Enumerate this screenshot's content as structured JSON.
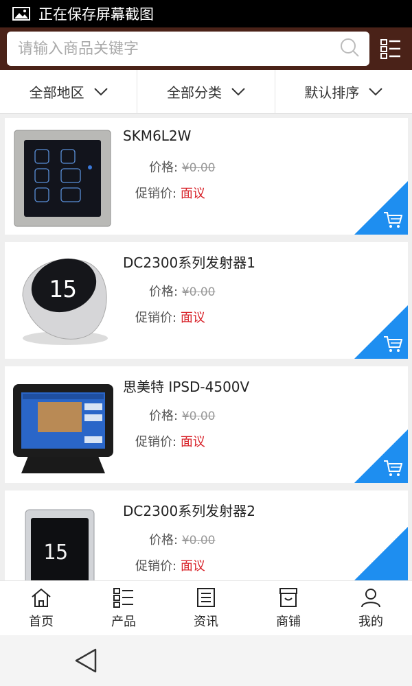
{
  "statusbar": {
    "text": "正在保存屏幕截图",
    "icon": "image-icon"
  },
  "search": {
    "placeholder": "请输入商品关键字",
    "icon": "search-icon",
    "menu_icon": "list-menu-icon"
  },
  "filters": [
    {
      "label": "全部地区"
    },
    {
      "label": "全部分类"
    },
    {
      "label": "默认排序"
    }
  ],
  "products": [
    {
      "name": "SKM6L2W",
      "price_label": "价格:",
      "price": "¥0.00",
      "promo_label": "促销价:",
      "promo": "面议"
    },
    {
      "name": "DC2300系列发射器1",
      "price_label": "价格:",
      "price": "¥0.00",
      "promo_label": "促销价:",
      "promo": "面议"
    },
    {
      "name": "思美特 IPSD-4500V",
      "price_label": "价格:",
      "price": "¥0.00",
      "promo_label": "促销价:",
      "promo": "面议"
    },
    {
      "name": "DC2300系列发射器2",
      "price_label": "价格:",
      "price": "¥0.00",
      "promo_label": "促销价:",
      "promo": "面议"
    }
  ],
  "tabs": [
    {
      "label": "首页",
      "icon": "home-icon"
    },
    {
      "label": "产品",
      "icon": "product-list-icon"
    },
    {
      "label": "资讯",
      "icon": "news-icon"
    },
    {
      "label": "商铺",
      "icon": "shop-icon"
    },
    {
      "label": "我的",
      "icon": "user-icon"
    }
  ],
  "colors": {
    "header": "#4a2218",
    "accent": "#1e8ef0",
    "promo": "#d8232a"
  }
}
